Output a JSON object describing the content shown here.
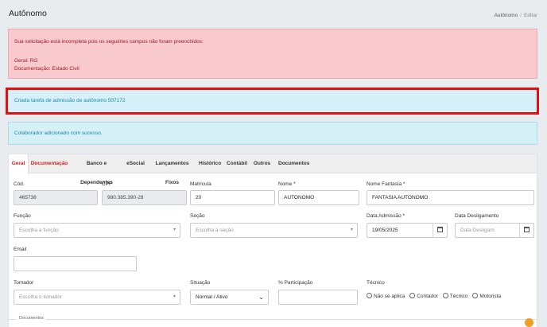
{
  "header": {
    "title": "Autônomo",
    "breadcrumb": [
      "Autônomo",
      "Editar"
    ],
    "breadcrumb_sep": "/"
  },
  "alerts": {
    "incomplete": {
      "intro": "Sua solicitação está incompleta pois os seguintes campos não foram preenchidos:",
      "lines": [
        "Geral: RG",
        "Documentação: Estado Civil"
      ]
    },
    "task": "Criada tarefa de admissão de autônomo 507172",
    "success": "Colaborador adicionado com sucesso."
  },
  "tabs": [
    {
      "label": "Geral",
      "state": "active"
    },
    {
      "label": "Documentação",
      "state": "error"
    },
    {
      "label": "Banco e Dependentes",
      "state": "normal"
    },
    {
      "label": "eSocial",
      "state": "normal"
    },
    {
      "label": "Lançamentos Fixos",
      "state": "normal"
    },
    {
      "label": "Histórico",
      "state": "normal"
    },
    {
      "label": "Contábil",
      "state": "normal"
    },
    {
      "label": "Outros",
      "state": "normal"
    },
    {
      "label": "Documentos",
      "state": "normal"
    }
  ],
  "form": {
    "cod": {
      "label": "Cód.",
      "value": "465738"
    },
    "cpf": {
      "label": "CPF",
      "value": "980.385.390-28"
    },
    "matricula": {
      "label": "Matrícula",
      "value": "20"
    },
    "nome": {
      "label": "Nome *",
      "value": "AUTONOMO"
    },
    "nome_fantasia": {
      "label": "Nome Fantasia *",
      "value": "FANTASIA AUTONOMO"
    },
    "funcao": {
      "label": "Função",
      "placeholder": "Escolha a função"
    },
    "secao": {
      "label": "Seção",
      "placeholder": "Escolha a seção"
    },
    "data_admissao": {
      "label": "Data Admissão *",
      "value": "19/05/2025"
    },
    "data_desligamento": {
      "label": "Data Desligamento",
      "placeholder": "Data Desligam."
    },
    "email": {
      "label": "Email",
      "value": ""
    },
    "tomador": {
      "label": "Tomador",
      "placeholder": "Escolha o tomador"
    },
    "situacao": {
      "label": "Situação",
      "value": "Normal / Ativo"
    },
    "participacao": {
      "label": "% Participação",
      "value": ""
    },
    "tecnico": {
      "label": "Técnico",
      "options": [
        "Não se aplica",
        "Contador",
        "Técnico",
        "Motorista"
      ]
    }
  },
  "section": {
    "documentos_legend": "Documentos"
  },
  "colors": {
    "accent_red": "#d0221c",
    "danger_bg": "#f8c9cd",
    "info_bg": "#d6f0f8",
    "highlight_border": "#e01010"
  }
}
